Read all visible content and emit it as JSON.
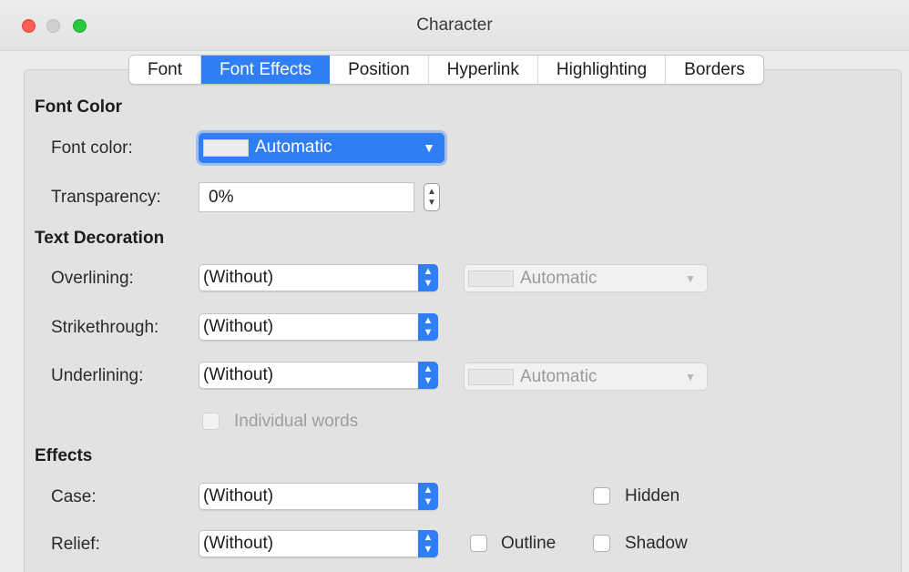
{
  "window": {
    "title": "Character"
  },
  "tabs": [
    "Font",
    "Font Effects",
    "Position",
    "Hyperlink",
    "Highlighting",
    "Borders"
  ],
  "font_color": {
    "heading": "Font Color",
    "font_color_label": "Font color:",
    "font_color_value": "Automatic",
    "transparency_label": "Transparency:",
    "transparency_value": "0%"
  },
  "text_decoration": {
    "heading": "Text Decoration",
    "overlining_label": "Overlining:",
    "overlining_value": "(Without)",
    "overlining_color": "Automatic",
    "strikethrough_label": "Strikethrough:",
    "strikethrough_value": "(Without)",
    "underlining_label": "Underlining:",
    "underlining_value": "(Without)",
    "underlining_color": "Automatic",
    "individual_words_label": "Individual words"
  },
  "effects": {
    "heading": "Effects",
    "case_label": "Case:",
    "case_value": "(Without)",
    "relief_label": "Relief:",
    "relief_value": "(Without)",
    "hidden_label": "Hidden",
    "outline_label": "Outline",
    "shadow_label": "Shadow"
  },
  "colors": {
    "accent": "#2f7ef6",
    "close": "#fd5f57",
    "maximize": "#27c840"
  }
}
